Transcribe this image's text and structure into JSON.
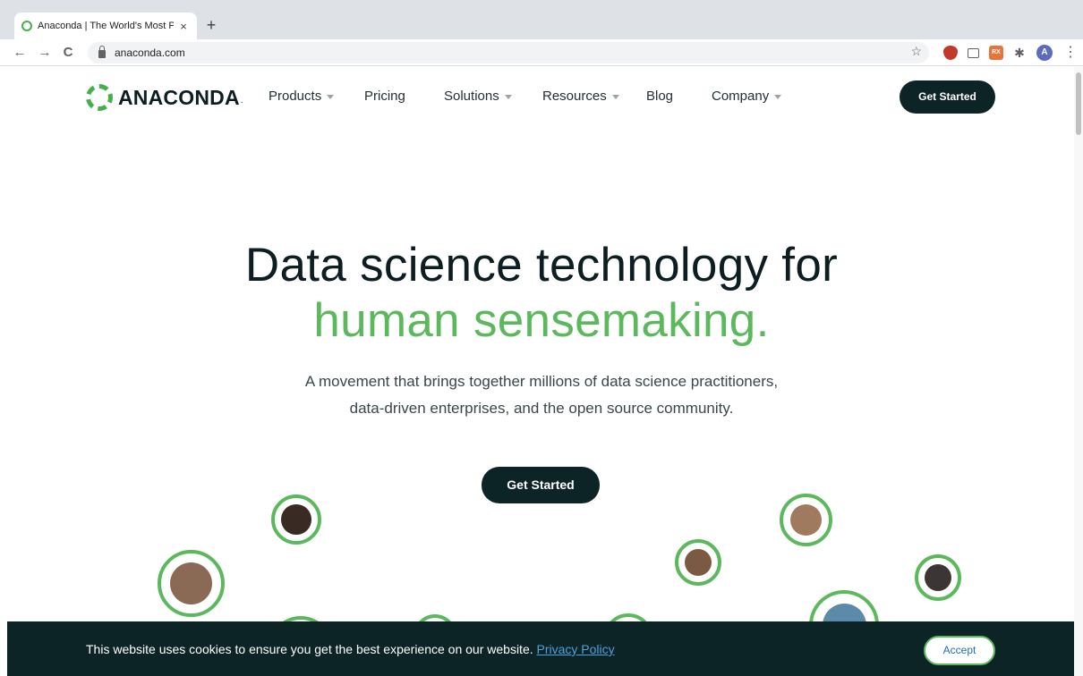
{
  "browser": {
    "tab_title": "Anaconda | The World's Most P",
    "tab_close": "×",
    "new_tab": "+",
    "back": "←",
    "forward": "→",
    "reload": "C",
    "url": "anaconda.com",
    "bookmark_star": "☆",
    "ext_rx_label": "RX",
    "puzzle": "✱",
    "profile_initial": "A",
    "menu": "⋮"
  },
  "header": {
    "logo_text": "ANACONDA",
    "logo_dot": ".",
    "nav": [
      {
        "label": "Products",
        "has_dropdown": true
      },
      {
        "label": "Pricing",
        "has_dropdown": false
      },
      {
        "label": "Solutions",
        "has_dropdown": true
      },
      {
        "label": "Resources",
        "has_dropdown": true
      },
      {
        "label": "Blog",
        "has_dropdown": false
      },
      {
        "label": "Company",
        "has_dropdown": true
      }
    ],
    "cta_label": "Get Started"
  },
  "hero": {
    "headline_line1": "Data science technology for",
    "headline_line2": "human sensemaking.",
    "subtitle_line1": "A movement that brings together millions of data science practitioners,",
    "subtitle_line2": "data-driven enterprises, and the open source community.",
    "cta_label": "Get Started"
  },
  "cookie_banner": {
    "message": "This website uses cookies to ensure you get the best experience on our website.",
    "link_label": "Privacy Policy",
    "accept_label": "Accept"
  },
  "colors": {
    "brand_green": "#5cb85c",
    "dark_teal": "#0d2426",
    "link_blue": "#4aa3df"
  }
}
